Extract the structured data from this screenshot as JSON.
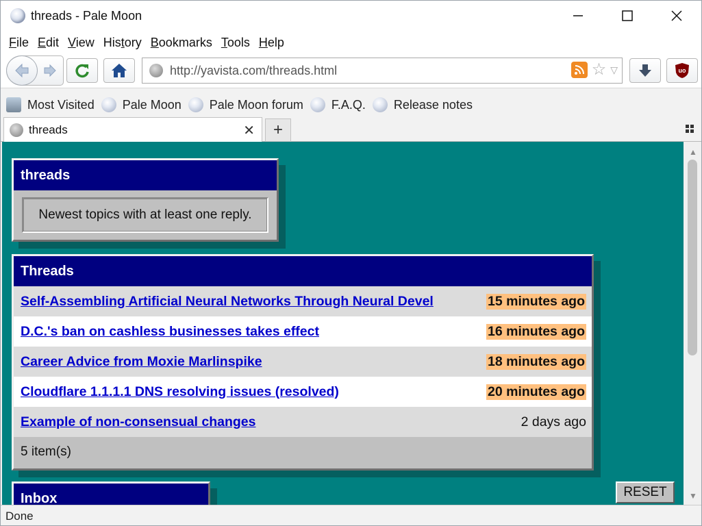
{
  "window": {
    "title": "threads - Pale Moon"
  },
  "menu": {
    "items": [
      "File",
      "Edit",
      "View",
      "History",
      "Bookmarks",
      "Tools",
      "Help"
    ]
  },
  "nav": {
    "url": "http://yavista.com/threads.html"
  },
  "bookmarks": {
    "items": [
      "Most Visited",
      "Pale Moon",
      "Pale Moon forum",
      "F.A.Q.",
      "Release notes"
    ]
  },
  "tab": {
    "title": "threads"
  },
  "page": {
    "threads_panel": {
      "title": "threads",
      "description": "Newest topics with at least one reply."
    },
    "list_panel": {
      "title": "Threads",
      "rows": [
        {
          "title": "Self-Assembling Artificial Neural Networks Through Neural Devel",
          "age": "15 minutes ago",
          "highlight": true
        },
        {
          "title": "D.C.'s ban on cashless businesses takes effect",
          "age": "16 minutes ago",
          "highlight": true
        },
        {
          "title": "Career Advice from Moxie Marlinspike",
          "age": "18 minutes ago",
          "highlight": true
        },
        {
          "title": "Cloudflare 1.1.1.1 DNS resolving issues (resolved)",
          "age": "20 minutes ago",
          "highlight": true
        },
        {
          "title": "Example of non-consensual changes",
          "age": "2 days ago",
          "highlight": false
        }
      ],
      "footer": "5 item(s)"
    },
    "inbox_panel": {
      "title": "Inbox"
    },
    "reset_label": "RESET"
  },
  "status": {
    "text": "Done"
  },
  "colors": {
    "page_bg": "#008080",
    "panel_header": "#000080",
    "highlight": "#ffc07f",
    "link": "#0000cc"
  }
}
